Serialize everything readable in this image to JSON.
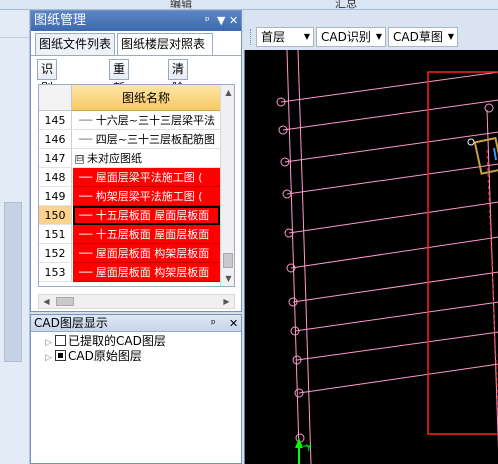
{
  "top_tabs": [
    "编辑",
    "汇总"
  ],
  "drawing_panel": {
    "title": "图纸管理",
    "title_buttons": [
      "ᵖ",
      "▼",
      "✕"
    ],
    "tabs": [
      "图纸文件列表",
      "图纸楼层对照表"
    ],
    "active_tab": 1,
    "buttons": [
      "识别楼层表",
      "重新对应",
      "清除对应"
    ],
    "table_header": "图纸名称",
    "rows": [
      {
        "num": "145",
        "prefix": "──",
        "text": "十六层~三十三层梁平法",
        "style": "normal"
      },
      {
        "num": "146",
        "prefix": "──",
        "text": "四层~三十三层板配筋图",
        "style": "normal"
      },
      {
        "num": "147",
        "prefix": "⊟",
        "text": "未对应图纸",
        "style": "group"
      },
      {
        "num": "148",
        "prefix": "──",
        "text": "屋面层梁平法施工图 (",
        "style": "red"
      },
      {
        "num": "149",
        "prefix": "──",
        "text": "构架层梁平法施工图 (",
        "style": "red"
      },
      {
        "num": "150",
        "prefix": "──",
        "text": "十五层板面 屋面层板面",
        "style": "red-selected"
      },
      {
        "num": "151",
        "prefix": "──",
        "text": "十五层板面 屋面层板面",
        "style": "red"
      },
      {
        "num": "152",
        "prefix": "──",
        "text": "屋面层板面 构架层板面",
        "style": "red"
      },
      {
        "num": "153",
        "prefix": "──",
        "text": "屋面层板面 构架层板面",
        "style": "red"
      }
    ]
  },
  "layer_panel": {
    "title": "CAD图层显示",
    "title_buttons": [
      "ᵖ",
      "✕"
    ],
    "items": [
      {
        "label": "已提取的CAD图层",
        "checked": "empty"
      },
      {
        "label": "CAD原始图层",
        "checked": "partial"
      }
    ]
  },
  "cad_toolbar": {
    "floor": "首层",
    "recognize": "CAD识别",
    "sketch": "CAD草图"
  },
  "colors": {
    "accent_red": "#ff0000",
    "cad_background": "#000000",
    "grid_lines": "#ff99cc",
    "selected_number": "#fbd38e",
    "header_gold": "#f7c964"
  }
}
